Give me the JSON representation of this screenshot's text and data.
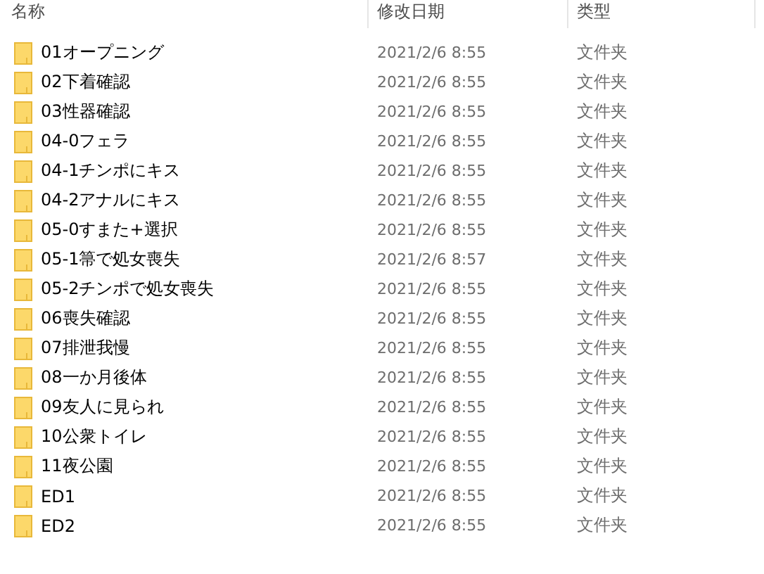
{
  "columns": [
    "名称",
    "修改日期",
    "类型"
  ],
  "rows": [
    {
      "name": "01オープニング",
      "date": "2021/2/6 8:55",
      "type": "文件夹"
    },
    {
      "name": "02下着確認",
      "date": "2021/2/6 8:55",
      "type": "文件夹"
    },
    {
      "name": "03性器確認",
      "date": "2021/2/6 8:55",
      "type": "文件夹"
    },
    {
      "name": "04-0フェラ",
      "date": "2021/2/6 8:55",
      "type": "文件夹"
    },
    {
      "name": "04-1チンポにキス",
      "date": "2021/2/6 8:55",
      "type": "文件夹"
    },
    {
      "name": "04-2アナルにキス",
      "date": "2021/2/6 8:55",
      "type": "文件夹"
    },
    {
      "name": "05-0すまた+選択",
      "date": "2021/2/6 8:55",
      "type": "文件夹"
    },
    {
      "name": "05-1箒で処女喪失",
      "date": "2021/2/6 8:57",
      "type": "文件夹"
    },
    {
      "name": "05-2チンポで処女喪失",
      "date": "2021/2/6 8:55",
      "type": "文件夹"
    },
    {
      "name": "06喪失確認",
      "date": "2021/2/6 8:55",
      "type": "文件夹"
    },
    {
      "name": "07排泄我慢",
      "date": "2021/2/6 8:55",
      "type": "文件夹"
    },
    {
      "name": "08一か月後体",
      "date": "2021/2/6 8:55",
      "type": "文件夹"
    },
    {
      "name": "09友人に見られ",
      "date": "2021/2/6 8:55",
      "type": "文件夹"
    },
    {
      "name": "10公衆トイレ",
      "date": "2021/2/6 8:55",
      "type": "文件夹"
    },
    {
      "name": "11夜公園",
      "date": "2021/2/6 8:55",
      "type": "文件夹"
    },
    {
      "name": "ED1",
      "date": "2021/2/6 8:55",
      "type": "文件夹"
    },
    {
      "name": "ED2",
      "date": "2021/2/6 8:55",
      "type": "文件夹"
    }
  ]
}
